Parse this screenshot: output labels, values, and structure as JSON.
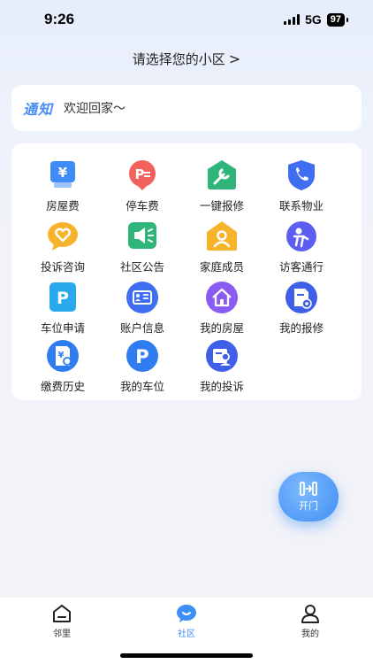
{
  "status_bar": {
    "time": "9:26",
    "network": "5G",
    "battery": "97"
  },
  "header": {
    "community_prompt": "请选择您的小区",
    "chevron": ">"
  },
  "notice": {
    "tag": "通知",
    "text": "欢迎回家～"
  },
  "services": [
    {
      "label": "房屋费",
      "icon": "yuan-card-icon"
    },
    {
      "label": "停车费",
      "icon": "parking-fee-icon"
    },
    {
      "label": "一键报修",
      "icon": "wrench-icon"
    },
    {
      "label": "联系物业",
      "icon": "phone-shield-icon"
    },
    {
      "label": "投诉咨询",
      "icon": "heart-chat-icon"
    },
    {
      "label": "社区公告",
      "icon": "megaphone-icon"
    },
    {
      "label": "家庭成员",
      "icon": "family-member-icon"
    },
    {
      "label": "访客通行",
      "icon": "visitor-icon"
    },
    {
      "label": "车位申请",
      "icon": "parking-apply-icon"
    },
    {
      "label": "账户信息",
      "icon": "id-card-icon"
    },
    {
      "label": "我的房屋",
      "icon": "house-icon"
    },
    {
      "label": "我的报修",
      "icon": "repair-doc-icon"
    },
    {
      "label": "缴费历史",
      "icon": "payment-history-icon"
    },
    {
      "label": "我的车位",
      "icon": "parking-space-icon"
    },
    {
      "label": "我的投诉",
      "icon": "complaint-icon"
    }
  ],
  "fab": {
    "label": "开门",
    "icon": "door-open-icon"
  },
  "tab_bar": {
    "items": [
      {
        "label": "邻里",
        "icon": "neighbor-home-icon"
      },
      {
        "label": "社区",
        "icon": "community-chat-icon"
      },
      {
        "label": "我的",
        "icon": "user-icon"
      }
    ],
    "active": "社区"
  }
}
